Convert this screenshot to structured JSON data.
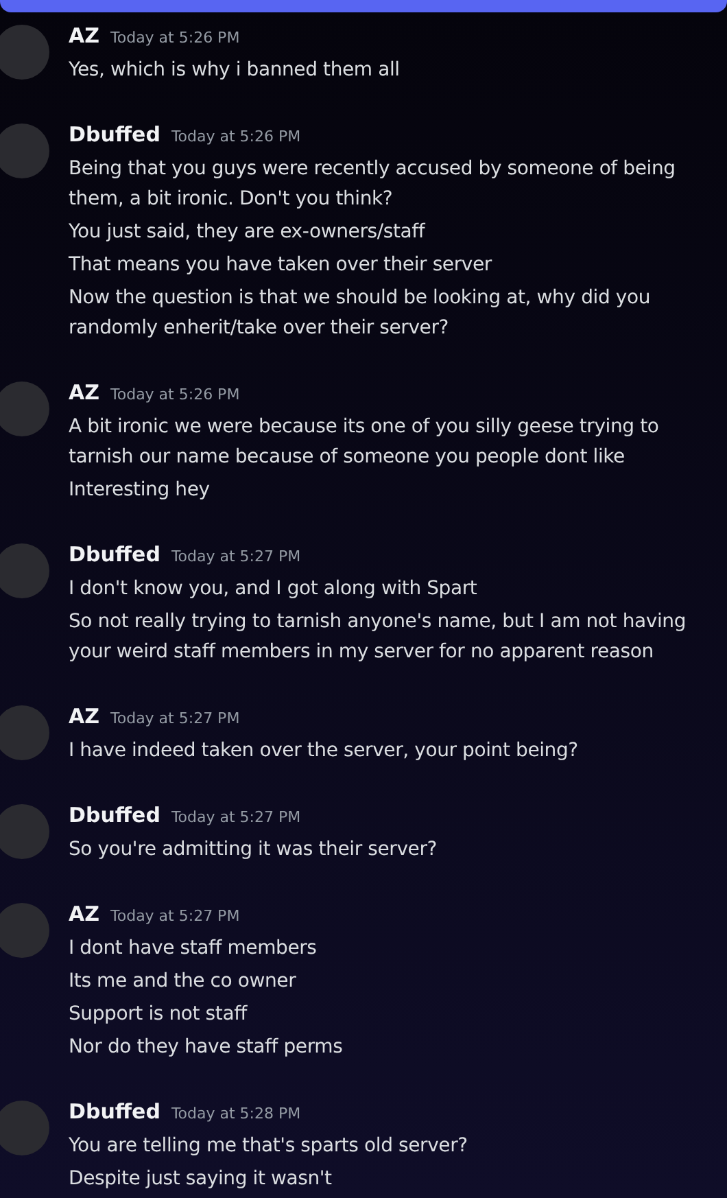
{
  "groups": [
    {
      "author": "AZ",
      "time": "Today at 5:26 PM",
      "messages": [
        "Yes, which is why i banned them all"
      ]
    },
    {
      "author": "Dbuffed",
      "time": "Today at 5:26 PM",
      "messages": [
        "Being that you guys were recently accused by someone of being them, a bit ironic. Don't you think?",
        "You just said, they are ex-owners/staff",
        "That means you have taken over their server",
        "Now the question is that we should be looking at, why did you randomly enherit/take over their server?"
      ]
    },
    {
      "author": "AZ",
      "time": "Today at 5:26 PM",
      "messages": [
        "A bit ironic we were because its one of you silly geese trying to tarnish our name because of someone you people dont like",
        "Interesting hey"
      ]
    },
    {
      "author": "Dbuffed",
      "time": "Today at 5:27 PM",
      "messages": [
        "I don't know you, and I got along with Spart",
        "So not really trying to tarnish anyone's name, but I am not having your weird staff members in my server for no apparent reason"
      ]
    },
    {
      "author": "AZ",
      "time": "Today at 5:27 PM",
      "messages": [
        "I have indeed taken over the server, your point being?"
      ]
    },
    {
      "author": "Dbuffed",
      "time": "Today at 5:27 PM",
      "messages": [
        "So you're admitting it was their server?"
      ]
    },
    {
      "author": "AZ",
      "time": "Today at 5:27 PM",
      "messages": [
        "I dont have staff members",
        "Its me and the co owner",
        "Support is not staff",
        "Nor do they have staff perms"
      ]
    },
    {
      "author": "Dbuffed",
      "time": "Today at 5:28 PM",
      "messages": [
        "You are telling me that's sparts old server?",
        "Despite just saying it wasn't"
      ]
    }
  ]
}
